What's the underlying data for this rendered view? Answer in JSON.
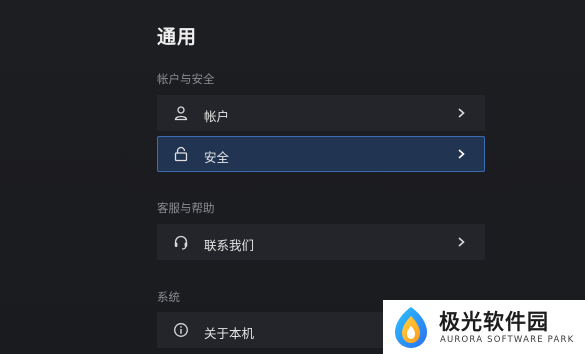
{
  "page": {
    "title": "通用"
  },
  "sections": {
    "account": {
      "label": "帐户与安全",
      "items": [
        {
          "label": "帐户",
          "icon": "user-icon"
        },
        {
          "label": "安全",
          "icon": "lock-icon",
          "selected": true
        }
      ]
    },
    "support": {
      "label": "客服与帮助",
      "items": [
        {
          "label": "联系我们",
          "icon": "headset-icon"
        }
      ]
    },
    "system": {
      "label": "系统",
      "items": [
        {
          "label": "关于本机",
          "icon": "info-icon"
        }
      ]
    }
  },
  "watermark": {
    "brand": "极光软件园",
    "subtitle": "AURORA SOFTWARE PARK"
  },
  "colors": {
    "background": "#1b1c20",
    "row": "#23252a",
    "selected_row": "#213452",
    "selected_border": "#3b6db3"
  }
}
